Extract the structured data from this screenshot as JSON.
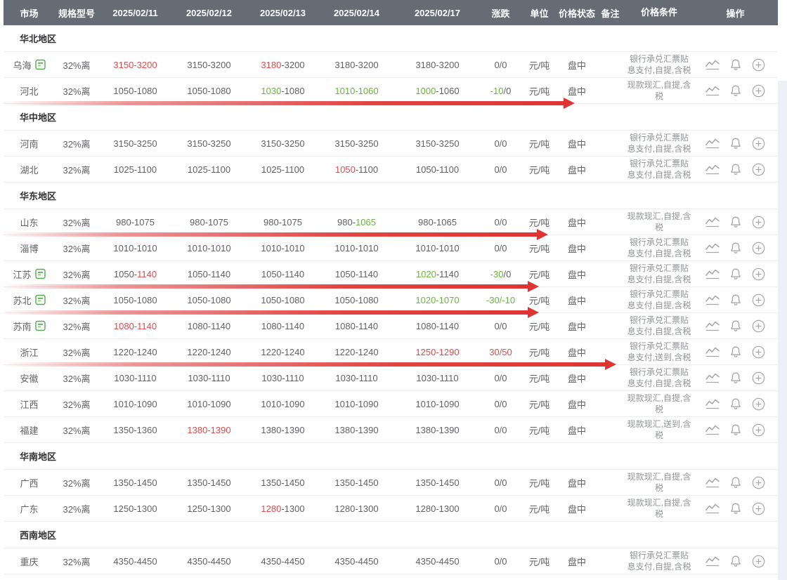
{
  "colors": {
    "header_bg": "#656c75",
    "header_text": "#ffffff",
    "value_text": "#606266",
    "region_text": "#303133",
    "condition_text": "#909399",
    "price_up_red": "#e14b4b",
    "price_down_green": "#67b83a",
    "annotation_arrow_red": "#e03434",
    "doc_icon_green": "#57a957",
    "action_icon_gray": "#a6a6a6",
    "row_border": "#ededed"
  },
  "icons": {
    "doc": "report-doc-icon",
    "trend": "line-chart-icon",
    "alert": "bell-icon",
    "add": "plus-circle-icon"
  },
  "table": {
    "columns": [
      "市场",
      "规格型号",
      "2025/02/11",
      "2025/02/12",
      "2025/02/13",
      "2025/02/14",
      "2025/02/17",
      "涨跌",
      "单位",
      "价格状态",
      "备注",
      "价格条件",
      "操作"
    ],
    "groups": [
      {
        "region": "华北地区",
        "rows": [
          {
            "market": "乌海",
            "doc_icon": true,
            "spec": "32%离",
            "prices": [
              [
                {
                  "t": "3150-3200",
                  "c": "r"
                }
              ],
              [
                {
                  "t": "3150-3200",
                  "c": "n"
                }
              ],
              [
                {
                  "t": "3180",
                  "c": "r"
                },
                {
                  "t": "-3200",
                  "c": "n"
                }
              ],
              [
                {
                  "t": "3180-3200",
                  "c": "n"
                }
              ],
              [
                {
                  "t": "3180-3200",
                  "c": "n"
                }
              ]
            ],
            "change": [
              {
                "t": "0/0",
                "c": "n"
              }
            ],
            "unit": "元/吨",
            "status": "盘中",
            "note": "",
            "condition": "银行承兑汇票贴息支付,自提,含税",
            "arrow": null
          },
          {
            "market": "河北",
            "doc_icon": false,
            "spec": "32%离",
            "prices": [
              [
                {
                  "t": "1050-1080",
                  "c": "n"
                }
              ],
              [
                {
                  "t": "1050-1080",
                  "c": "n"
                }
              ],
              [
                {
                  "t": "1030",
                  "c": "g"
                },
                {
                  "t": "-1080",
                  "c": "n"
                }
              ],
              [
                {
                  "t": "1010-1060",
                  "c": "g"
                }
              ],
              [
                {
                  "t": "1000",
                  "c": "g"
                },
                {
                  "t": "-1060",
                  "c": "n"
                }
              ]
            ],
            "change": [
              {
                "t": "-10",
                "c": "g"
              },
              {
                "t": "/0",
                "c": "n"
              }
            ],
            "unit": "元/吨",
            "status": "盘中",
            "note": "",
            "condition": "现款现汇,自提,含税",
            "arrow": 818
          }
        ]
      },
      {
        "region": "华中地区",
        "rows": [
          {
            "market": "河南",
            "doc_icon": false,
            "spec": "32%离",
            "prices": [
              [
                {
                  "t": "3150-3250",
                  "c": "n"
                }
              ],
              [
                {
                  "t": "3150-3250",
                  "c": "n"
                }
              ],
              [
                {
                  "t": "3150-3250",
                  "c": "n"
                }
              ],
              [
                {
                  "t": "3150-3250",
                  "c": "n"
                }
              ],
              [
                {
                  "t": "3150-3250",
                  "c": "n"
                }
              ]
            ],
            "change": [
              {
                "t": "0/0",
                "c": "n"
              }
            ],
            "unit": "元/吨",
            "status": "盘中",
            "note": "",
            "condition": "银行承兑汇票贴息支付,自提,含税",
            "arrow": null
          },
          {
            "market": "湖北",
            "doc_icon": false,
            "spec": "32%离",
            "prices": [
              [
                {
                  "t": "1025-1100",
                  "c": "n"
                }
              ],
              [
                {
                  "t": "1025-1100",
                  "c": "n"
                }
              ],
              [
                {
                  "t": "1025-1100",
                  "c": "n"
                }
              ],
              [
                {
                  "t": "1050",
                  "c": "r"
                },
                {
                  "t": "-1100",
                  "c": "n"
                }
              ],
              [
                {
                  "t": "1050-1100",
                  "c": "n"
                }
              ]
            ],
            "change": [
              {
                "t": "0/0",
                "c": "n"
              }
            ],
            "unit": "元/吨",
            "status": "盘中",
            "note": "",
            "condition": "银行承兑汇票贴息支付,自提,含税",
            "arrow": null
          }
        ]
      },
      {
        "region": "华东地区",
        "rows": [
          {
            "market": "山东",
            "doc_icon": false,
            "spec": "32%离",
            "prices": [
              [
                {
                  "t": "980-1075",
                  "c": "n"
                }
              ],
              [
                {
                  "t": "980-1075",
                  "c": "n"
                }
              ],
              [
                {
                  "t": "980-1075",
                  "c": "n"
                }
              ],
              [
                {
                  "t": "980-",
                  "c": "n"
                },
                {
                  "t": "1065",
                  "c": "g"
                }
              ],
              [
                {
                  "t": "980-1065",
                  "c": "n"
                }
              ]
            ],
            "change": [
              {
                "t": "0/0",
                "c": "n"
              }
            ],
            "unit": "元/吨",
            "status": "盘中",
            "note": "",
            "condition": "现款现汇,自提,含税",
            "arrow": 780
          },
          {
            "market": "淄博",
            "doc_icon": false,
            "spec": "32%离",
            "prices": [
              [
                {
                  "t": "1010-1010",
                  "c": "n"
                }
              ],
              [
                {
                  "t": "1010-1010",
                  "c": "n"
                }
              ],
              [
                {
                  "t": "1010-1010",
                  "c": "n"
                }
              ],
              [
                {
                  "t": "1010-1010",
                  "c": "n"
                }
              ],
              [
                {
                  "t": "1010-1010",
                  "c": "n"
                }
              ]
            ],
            "change": [
              {
                "t": "0/0",
                "c": "n"
              }
            ],
            "unit": "元/吨",
            "status": "盘中",
            "note": "",
            "condition": "银行承兑汇票贴息支付,自提,含税",
            "arrow": null
          },
          {
            "market": "江苏",
            "doc_icon": true,
            "spec": "32%离",
            "prices": [
              [
                {
                  "t": "1050-",
                  "c": "n"
                },
                {
                  "t": "1140",
                  "c": "r"
                }
              ],
              [
                {
                  "t": "1050-1140",
                  "c": "n"
                }
              ],
              [
                {
                  "t": "1050-1140",
                  "c": "n"
                }
              ],
              [
                {
                  "t": "1050-1140",
                  "c": "n"
                }
              ],
              [
                {
                  "t": "1020",
                  "c": "g"
                },
                {
                  "t": "-1140",
                  "c": "n"
                }
              ]
            ],
            "change": [
              {
                "t": "-30",
                "c": "g"
              },
              {
                "t": "/0",
                "c": "n"
              }
            ],
            "unit": "元/吨",
            "status": "盘中",
            "note": "",
            "condition": "银行承兑汇票贴息支付,自提,含税",
            "arrow": 767
          },
          {
            "market": "苏北",
            "doc_icon": true,
            "spec": "32%离",
            "prices": [
              [
                {
                  "t": "1050-1080",
                  "c": "n"
                }
              ],
              [
                {
                  "t": "1050-1080",
                  "c": "n"
                }
              ],
              [
                {
                  "t": "1050-1080",
                  "c": "n"
                }
              ],
              [
                {
                  "t": "1050-1080",
                  "c": "n"
                }
              ],
              [
                {
                  "t": "1020-1070",
                  "c": "g"
                }
              ]
            ],
            "change": [
              {
                "t": "-30/-10",
                "c": "g"
              }
            ],
            "unit": "元/吨",
            "status": "盘中",
            "note": "",
            "condition": "银行承兑汇票贴息支付,自提,含税",
            "arrow": 767
          },
          {
            "market": "苏南",
            "doc_icon": true,
            "spec": "32%离",
            "prices": [
              [
                {
                  "t": "1080-1140",
                  "c": "r"
                }
              ],
              [
                {
                  "t": "1080-1140",
                  "c": "n"
                }
              ],
              [
                {
                  "t": "1080-1140",
                  "c": "n"
                }
              ],
              [
                {
                  "t": "1080-1140",
                  "c": "n"
                }
              ],
              [
                {
                  "t": "1080-1140",
                  "c": "n"
                }
              ]
            ],
            "change": [
              {
                "t": "0/0",
                "c": "n"
              }
            ],
            "unit": "元/吨",
            "status": "盘中",
            "note": "",
            "condition": "银行承兑汇票贴息支付,自提,含税",
            "arrow": null
          },
          {
            "market": "浙江",
            "doc_icon": false,
            "spec": "32%离",
            "prices": [
              [
                {
                  "t": "1220-1240",
                  "c": "n"
                }
              ],
              [
                {
                  "t": "1220-1240",
                  "c": "n"
                }
              ],
              [
                {
                  "t": "1220-1240",
                  "c": "n"
                }
              ],
              [
                {
                  "t": "1220-1240",
                  "c": "n"
                }
              ],
              [
                {
                  "t": "1250-1290",
                  "c": "r"
                }
              ]
            ],
            "change": [
              {
                "t": "30/50",
                "c": "r"
              }
            ],
            "unit": "元/吨",
            "status": "盘中",
            "note": "",
            "condition": "银行承兑汇票贴息支付,送到,含税",
            "arrow": 877
          },
          {
            "market": "安徽",
            "doc_icon": false,
            "spec": "32%离",
            "prices": [
              [
                {
                  "t": "1030-1110",
                  "c": "n"
                }
              ],
              [
                {
                  "t": "1030-1110",
                  "c": "n"
                }
              ],
              [
                {
                  "t": "1030-1110",
                  "c": "n"
                }
              ],
              [
                {
                  "t": "1030-1110",
                  "c": "n"
                }
              ],
              [
                {
                  "t": "1030-1110",
                  "c": "n"
                }
              ]
            ],
            "change": [
              {
                "t": "0/0",
                "c": "n"
              }
            ],
            "unit": "元/吨",
            "status": "盘中",
            "note": "",
            "condition": "银行承兑汇票贴息支付,自提,含税",
            "arrow": null
          },
          {
            "market": "江西",
            "doc_icon": false,
            "spec": "32%离",
            "prices": [
              [
                {
                  "t": "1010-1090",
                  "c": "n"
                }
              ],
              [
                {
                  "t": "1010-1090",
                  "c": "n"
                }
              ],
              [
                {
                  "t": "1010-1090",
                  "c": "n"
                }
              ],
              [
                {
                  "t": "1010-1090",
                  "c": "n"
                }
              ],
              [
                {
                  "t": "1010-1090",
                  "c": "n"
                }
              ]
            ],
            "change": [
              {
                "t": "0/0",
                "c": "n"
              }
            ],
            "unit": "元/吨",
            "status": "盘中",
            "note": "",
            "condition": "现款现汇,自提,含税",
            "arrow": null
          },
          {
            "market": "福建",
            "doc_icon": false,
            "spec": "32%离",
            "prices": [
              [
                {
                  "t": "1350-1360",
                  "c": "n"
                }
              ],
              [
                {
                  "t": "1380-1390",
                  "c": "r"
                }
              ],
              [
                {
                  "t": "1380-1390",
                  "c": "n"
                }
              ],
              [
                {
                  "t": "1380-1390",
                  "c": "n"
                }
              ],
              [
                {
                  "t": "1380-1390",
                  "c": "n"
                }
              ]
            ],
            "change": [
              {
                "t": "0/0",
                "c": "n"
              }
            ],
            "unit": "元/吨",
            "status": "盘中",
            "note": "",
            "condition": "现款现汇,送到,含税",
            "arrow": null
          }
        ]
      },
      {
        "region": "华南地区",
        "rows": [
          {
            "market": "广西",
            "doc_icon": false,
            "spec": "32%离",
            "prices": [
              [
                {
                  "t": "1350-1450",
                  "c": "n"
                }
              ],
              [
                {
                  "t": "1350-1450",
                  "c": "n"
                }
              ],
              [
                {
                  "t": "1350-1450",
                  "c": "n"
                }
              ],
              [
                {
                  "t": "1350-1450",
                  "c": "n"
                }
              ],
              [
                {
                  "t": "1350-1450",
                  "c": "n"
                }
              ]
            ],
            "change": [
              {
                "t": "0/0",
                "c": "n"
              }
            ],
            "unit": "元/吨",
            "status": "盘中",
            "note": "",
            "condition": "现款现汇,自提,含税",
            "arrow": null
          },
          {
            "market": "广东",
            "doc_icon": false,
            "spec": "32%离",
            "prices": [
              [
                {
                  "t": "1250-1300",
                  "c": "n"
                }
              ],
              [
                {
                  "t": "1250-1300",
                  "c": "n"
                }
              ],
              [
                {
                  "t": "1280",
                  "c": "r"
                },
                {
                  "t": "-1300",
                  "c": "n"
                }
              ],
              [
                {
                  "t": "1280-1300",
                  "c": "n"
                }
              ],
              [
                {
                  "t": "1280-1300",
                  "c": "n"
                }
              ]
            ],
            "change": [
              {
                "t": "0/0",
                "c": "n"
              }
            ],
            "unit": "元/吨",
            "status": "盘中",
            "note": "",
            "condition": "现款现汇,自提,含税",
            "arrow": null
          }
        ]
      },
      {
        "region": "西南地区",
        "rows": [
          {
            "market": "重庆",
            "doc_icon": false,
            "spec": "32%离",
            "prices": [
              [
                {
                  "t": "4350-4450",
                  "c": "n"
                }
              ],
              [
                {
                  "t": "4350-4450",
                  "c": "n"
                }
              ],
              [
                {
                  "t": "4350-4450",
                  "c": "n"
                }
              ],
              [
                {
                  "t": "4350-4450",
                  "c": "n"
                }
              ],
              [
                {
                  "t": "4350-4450",
                  "c": "n"
                }
              ]
            ],
            "change": [
              {
                "t": "0/0",
                "c": "n"
              }
            ],
            "unit": "元/吨",
            "status": "盘中",
            "note": "",
            "condition": "银行承兑汇票贴息支付,自提,含税",
            "arrow": null
          }
        ]
      }
    ]
  }
}
